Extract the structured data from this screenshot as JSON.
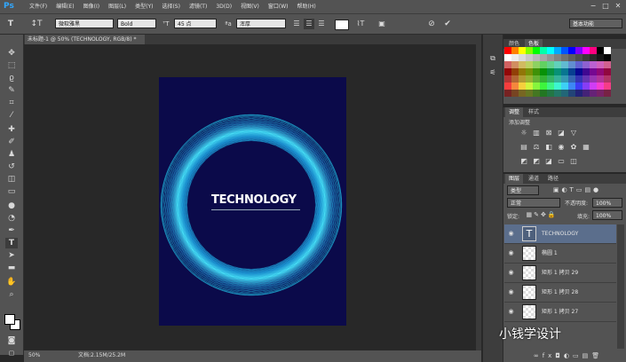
{
  "app": {
    "logo": "Ps"
  },
  "menu": [
    "文件(F)",
    "编辑(E)",
    "图像(I)",
    "图层(L)",
    "类型(Y)",
    "选择(S)",
    "滤镜(T)",
    "3D(D)",
    "视图(V)",
    "窗口(W)",
    "帮助(H)"
  ],
  "options": {
    "font_family": "微软雅黑",
    "font_style": "Bold",
    "font_size": "45 点",
    "antialias": "浑厚",
    "workspace": "基本功能",
    "color_swatch": "#ffffff"
  },
  "document": {
    "tab_title": "未标题-1 @ 50% (TECHNOLOGY, RGB/8) *",
    "background": "#0b0a4a",
    "text": "TECHNOLOGY"
  },
  "status": {
    "zoom": "50%",
    "doc_size": "文档:2.15M/25.2M"
  },
  "panels": {
    "swatch_tabs": [
      "颜色",
      "色板"
    ],
    "adjust_tabs": [
      "调整",
      "样式"
    ],
    "adjust_title": "添加调整",
    "layer_tabs": [
      "图层",
      "通道",
      "路径"
    ],
    "filter_kind": "类型",
    "blend_mode": "正常",
    "opacity_label": "不透明度:",
    "opacity_value": "100%",
    "lock_label": "锁定:",
    "fill_label": "填充:",
    "fill_value": "100%"
  },
  "layers": [
    {
      "name": "TECHNOLOGY",
      "kind": "text",
      "selected": true
    },
    {
      "name": "椭圆 1",
      "kind": "shape",
      "selected": false
    },
    {
      "name": "矩形 1 拷贝 29",
      "kind": "shape",
      "selected": false
    },
    {
      "name": "矩形 1 拷贝 28",
      "kind": "shape",
      "selected": false
    },
    {
      "name": "矩形 1 拷贝 27",
      "kind": "shape",
      "selected": false
    }
  ],
  "watermark": "小钱学设计",
  "colors": {
    "panel": "#535353",
    "canvas": "#282828",
    "selected_layer": "#5b6e8c",
    "ring_outer": "#1fb3d9",
    "ring_glow": "#4ee9ff"
  }
}
